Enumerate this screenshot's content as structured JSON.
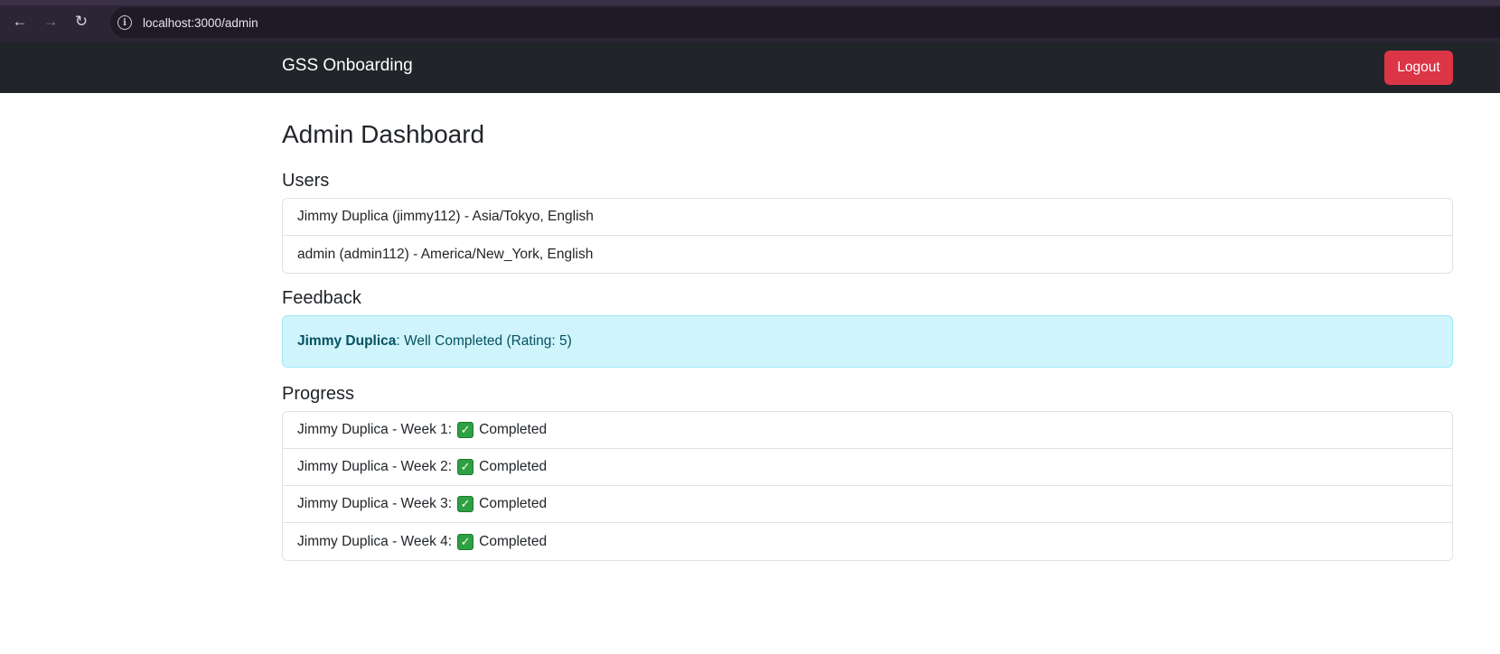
{
  "browser": {
    "url": "localhost:3000/admin"
  },
  "navbar": {
    "brand": "GSS Onboarding",
    "logout_label": "Logout"
  },
  "page": {
    "title": "Admin Dashboard"
  },
  "users": {
    "heading": "Users",
    "items": [
      {
        "text": "Jimmy Duplica (jimmy112) - Asia/Tokyo, English"
      },
      {
        "text": "admin (admin112) - America/New_York, English"
      }
    ]
  },
  "feedback": {
    "heading": "Feedback",
    "items": [
      {
        "name": "Jimmy Duplica",
        "text": ": Well Completed (Rating: 5)"
      }
    ]
  },
  "progress": {
    "heading": "Progress",
    "items": [
      {
        "label": "Jimmy Duplica - Week 1:",
        "status": "Completed",
        "icon": "check-mark-icon"
      },
      {
        "label": "Jimmy Duplica - Week 2:",
        "status": "Completed",
        "icon": "check-mark-icon"
      },
      {
        "label": "Jimmy Duplica - Week 3:",
        "status": "Completed",
        "icon": "check-mark-icon"
      },
      {
        "label": "Jimmy Duplica - Week 4:",
        "status": "Completed",
        "icon": "check-mark-icon"
      }
    ]
  },
  "colors": {
    "navbar_bg": "#212529",
    "logout_bg": "#dc3545",
    "alert_info_bg": "#cff4fc",
    "check_green": "#2ea043"
  }
}
